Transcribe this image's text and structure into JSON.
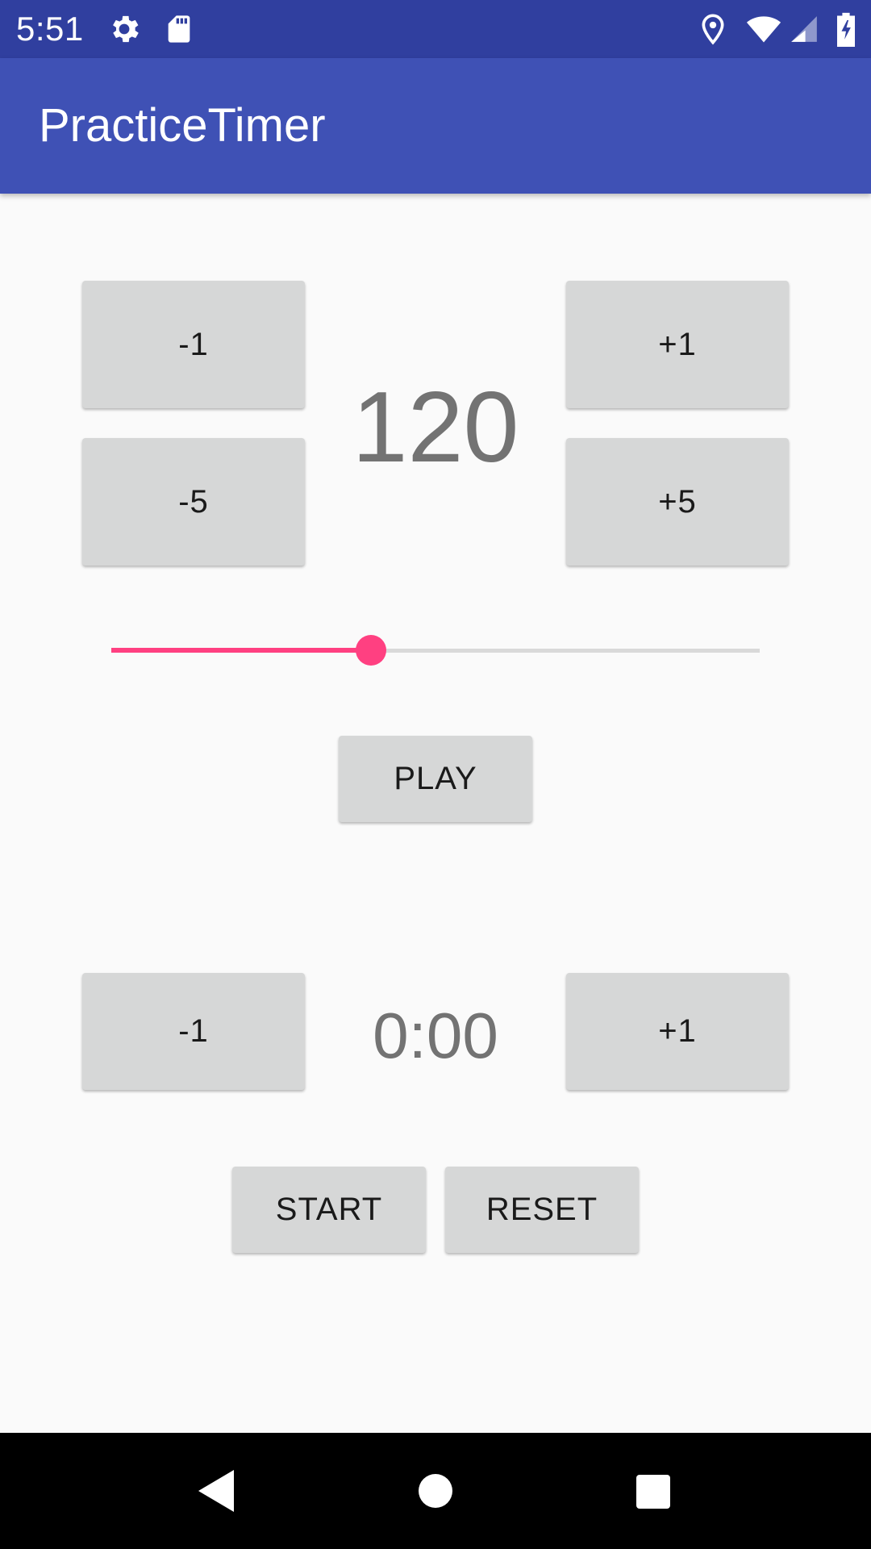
{
  "status_bar": {
    "time": "5:51",
    "icons_left": [
      "gear-icon",
      "sd-card-icon"
    ],
    "icons_right": [
      "location-icon",
      "wifi-icon",
      "cellular-signal-icon",
      "battery-charging-icon"
    ]
  },
  "app_bar": {
    "title": "PracticeTimer"
  },
  "tempo": {
    "value": "120",
    "minus1_label": "-1",
    "plus1_label": "+1",
    "minus5_label": "-5",
    "plus5_label": "+5",
    "slider_fraction": 0.4,
    "accent_color": "#ff4081"
  },
  "play_label": "PLAY",
  "timer": {
    "value": "0:00",
    "minus1_label": "-1",
    "plus1_label": "+1",
    "start_label": "START",
    "reset_label": "RESET"
  },
  "nav_bar": {
    "icons": [
      "back-icon",
      "home-icon",
      "recents-icon"
    ]
  },
  "colors": {
    "primary": "#3f51b5",
    "primary_dark": "#303f9f",
    "accent": "#ff4081"
  }
}
